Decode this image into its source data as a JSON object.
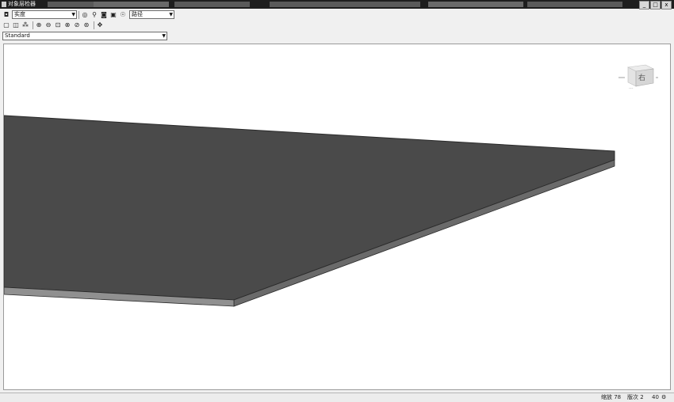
{
  "window": {
    "title": "对象层检器",
    "background_tabs": [
      "",
      "",
      "",
      ""
    ],
    "controls": {
      "minimize": "_",
      "maximize": "□",
      "close": "x"
    }
  },
  "toolbar1": {
    "view_combo": {
      "value": "实度"
    },
    "path_combo": {
      "value": "路径"
    }
  },
  "toolbar3": {
    "style_combo": {
      "value": "Standard"
    }
  },
  "viewcube": {
    "face_label": "右",
    "sub_label": "---"
  },
  "status": {
    "zoom_text": "缩放 78",
    "version_text": "版次 2",
    "extra": "40"
  },
  "icons": {
    "save": "◘",
    "orbit": "◎",
    "search": "⚲",
    "camera": "◙",
    "fit": "▣",
    "eye": "☉",
    "box": "▢",
    "cylinder": "◫",
    "grid": "⁂",
    "zoom_in": "⊕",
    "zoom_out": "⊖",
    "zoom_window": "⊡",
    "zoom_prev": "⊗",
    "zoom_next": "⊘",
    "zoom_all": "⊛",
    "pan": "✥"
  }
}
